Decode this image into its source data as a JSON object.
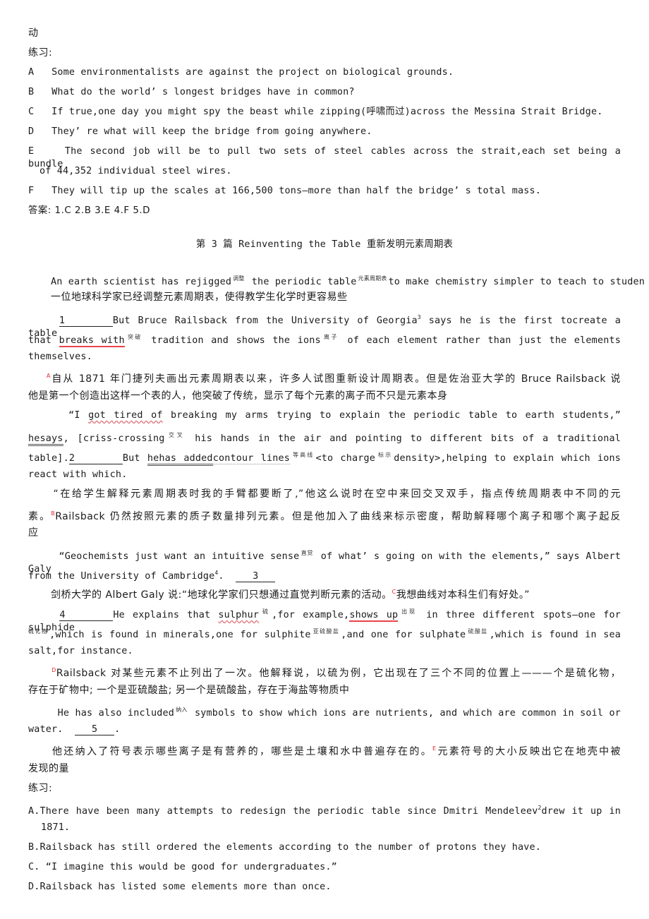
{
  "prev_section": {
    "trailing_char": "动",
    "exercise_label": "练习:",
    "options": [
      {
        "letter": "A",
        "text": "Some environmentalists are against the project on biological grounds."
      },
      {
        "letter": "B",
        "text": "What do the world’ s longest bridges have in common?"
      },
      {
        "letter": "C",
        "text": "If true,one day you might spy the beast while zipping(呼啸而过)across the Messina Strait Bridge."
      },
      {
        "letter": "D",
        "text": "They’ re what will keep the bridge from going anywhere."
      },
      {
        "letter": "E",
        "text": "The second job will be to pull two sets of steel cables across the strait,each set being a bundle",
        "text2": "of 44,352 individual steel wires."
      },
      {
        "letter": "F",
        "text": "They will tip up the scales at 166,500 tons—more than half the bridge’ s total mass."
      }
    ],
    "answer": "答案: 1.C 2.B 3.E 4.F 5.D"
  },
  "article": {
    "title": "第 3 篇 Reinventing the Table 重新发明元素周期表",
    "p1": {
      "a": "An earth scientist has rejigged",
      "g1": "调整",
      "b": "the periodic table",
      "g2": "元素周期表",
      "c": "to make chemistry simpler to teach to studen",
      "cn": "一位地球科学家已经调整元素周期表，使得教学生化学时更容易些"
    },
    "p2": {
      "blank": "1",
      "a": "But Bruce Railsback from the University of Georgia",
      "fn": "3",
      "b": "says he is the first tocreate a table",
      "c": "that",
      "u1": "breaks with",
      "g1": "突破",
      "d": "tradition and shows the ions",
      "g2": "离子",
      "e": "of each element rather than just the elements",
      "f": "themselves.",
      "marker": "A",
      "cn1": "自从 1871 年门捷列夫画出元素周期表以来，许多人试图重新设计周期表。但是佐治亚大学的 Bruce Railsback 说",
      "cn2": "他是第一个创造出这样一个表的人，他突破了传统，显示了每个元素的离子而不只是元素本身"
    },
    "p3": {
      "q": "“I",
      "u1": "got tired of",
      "a": "breaking my arms trying to explain the periodic table to earth students,”",
      "u2": "hesays",
      "b": ",  [criss-crossing",
      "g1": "交叉",
      "c": "his hands in the air and pointing to different bits of a traditional",
      "d": "table].",
      "blank": "2",
      "e": "But",
      "u3": "hehas added",
      "u4": "contour lines",
      "g2": "等高线",
      "f": "<to charge",
      "g3": "标示",
      "g": "density>,helping to explain which ions",
      "h": "react with which.",
      "cn1": "“在给学生解释元素周期表时我的手臂都要断了,”他这么说时在空中来回交叉双手，指点传统周期表中不同的元",
      "cn2a": "素。",
      "marker": "B",
      "cn2b": "Railsback 仍然按照元素的质子数量排列元素。但是他加入了曲线来标示密度，帮助解释哪个离子和哪个离子起反",
      "cn3": "应"
    },
    "p4": {
      "a": "“Geochemists just want an intuitive sense",
      "g1": "直觉",
      "b": "of what’ s going on with the elements,” says Albert Galy",
      "c": "from the University of Cambridge",
      "fn": "4",
      "d": ".",
      "blank": "3",
      "cn_a": "剑桥大学的 Albert Galy 说:“地球化学家们只想通过直觉判断元素的活动。",
      "marker": "C",
      "cn_b": "我想曲线对本科生们有好处。”"
    },
    "p5": {
      "blank": "4",
      "a": "He explains that",
      "u1": "sulphur",
      "g1": "硫",
      "b": ",for example,",
      "u2": "shows up",
      "g2": "出现",
      "c": "in three different spots—one for sulphide",
      "g3": "硫化物",
      "d": ",which is found in minerals,one for sulphite",
      "g4": "亚硫酸盐",
      "e": ",and one for sulphate",
      "g5": "硫酸盐",
      "f": ",which is found in sea",
      "g": "salt,for instance.",
      "marker": "D",
      "cn1": "Railsback 对某些元素不止列出了一次。他解释说，以硫为例，它出现在了三个不同的位置上———个是硫化物，",
      "cn2": "存在于矿物中; 一个是亚硫酸盐; 另一个是硫酸盐，存在于海盐等物质中"
    },
    "p6": {
      "a": "He has also included",
      "g1": "纳入",
      "b": "symbols to show which ions are nutrients, and which are common in soil or",
      "c": "water.",
      "blank": "5",
      "d": ".",
      "cn1a": "他还纳入了符号表示哪些离子是有营养的，哪些是土壤和水中普遍存在的。",
      "marker": "E",
      "cn1b": "元素符号的大小反映出它在地壳中被",
      "cn2": "发现的量"
    },
    "exercise_label": "练习:",
    "options": [
      {
        "label": "A.There have been many attempts to redesign the periodic table since Dmitri Mendeleev",
        "fn": "2",
        "label2": "drew it up in",
        "cont": "1871."
      },
      {
        "label": "B.Railsback has still ordered the elements according to the number of protons they have."
      },
      {
        "label": "C. “I imagine this would be good for undergraduates.”"
      },
      {
        "label": "D.Railsback has listed some elements more than once."
      }
    ]
  },
  "colors": {
    "annotation_red": "#e6262e",
    "underline_red": "#e8434a"
  }
}
